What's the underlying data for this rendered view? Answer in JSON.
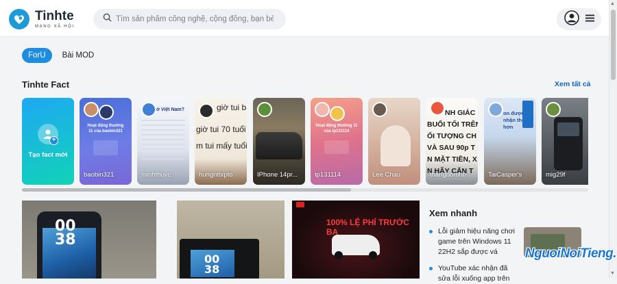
{
  "header": {
    "brand_name": "Tinhte",
    "brand_sub": "MẠNG XÃ HỘI",
    "search_placeholder": "Tìm sản phẩm công nghệ, cộng đồng, bạn bè,..."
  },
  "tabs": [
    {
      "label": "ForU",
      "active": true
    },
    {
      "label": "Bài MOD",
      "active": false
    }
  ],
  "fact_section": {
    "title": "Tinhte Fact",
    "see_all": "Xem tất cả",
    "create_label": "Tạo fact mới",
    "cards": [
      {
        "name": "baobin321"
      },
      {
        "name": "minhthuvc"
      },
      {
        "name": "hungnttxpto"
      },
      {
        "name": "IPhone 14pr..."
      },
      {
        "name": "tp131114"
      },
      {
        "name": "Lee Chau"
      },
      {
        "name": "thangbomhb"
      },
      {
        "name": "TaiCasper's"
      },
      {
        "name": "mig29f"
      }
    ],
    "card_texts": {
      "baobin_text": "Hoạt động thường 11 của baobin321",
      "minh_title": "ở Việt Nam?",
      "hung_lines": [
        "giờ tui bằng",
        "giờ tui 70 tuổi",
        "m tui mấy tuổi"
      ],
      "tp_text": "Hoạt động thường 11 của tp131114",
      "thang_lines": [
        "NH GIÁC",
        "BUỔI TỐI TRÊN",
        "ỐI TƯỢNG CH",
        "VÀ SAU 90p T",
        "N MẶT TIỀN, X",
        "N HÃY CẨN T"
      ],
      "tai_text": "on được nhận thêm hơn"
    }
  },
  "quick_view": {
    "title": "Xem nhanh",
    "items": [
      {
        "text": "Lỗi giảm hiệu năng chơi game trên Windows 11 22H2 sắp được vá"
      },
      {
        "text": "YouTube xác nhận đã sửa lỗi xuống app trên"
      }
    ]
  },
  "posts": {
    "phone_clock": [
      "00",
      "38"
    ],
    "honda_banner": "100% LỆ PHÍ TRƯỚC BẠ"
  },
  "watermark": "NguoiNoiTieng.TV",
  "colors": {
    "accent": "#1e8de0",
    "brand": "#1e9bd7",
    "link": "#1565c0"
  }
}
